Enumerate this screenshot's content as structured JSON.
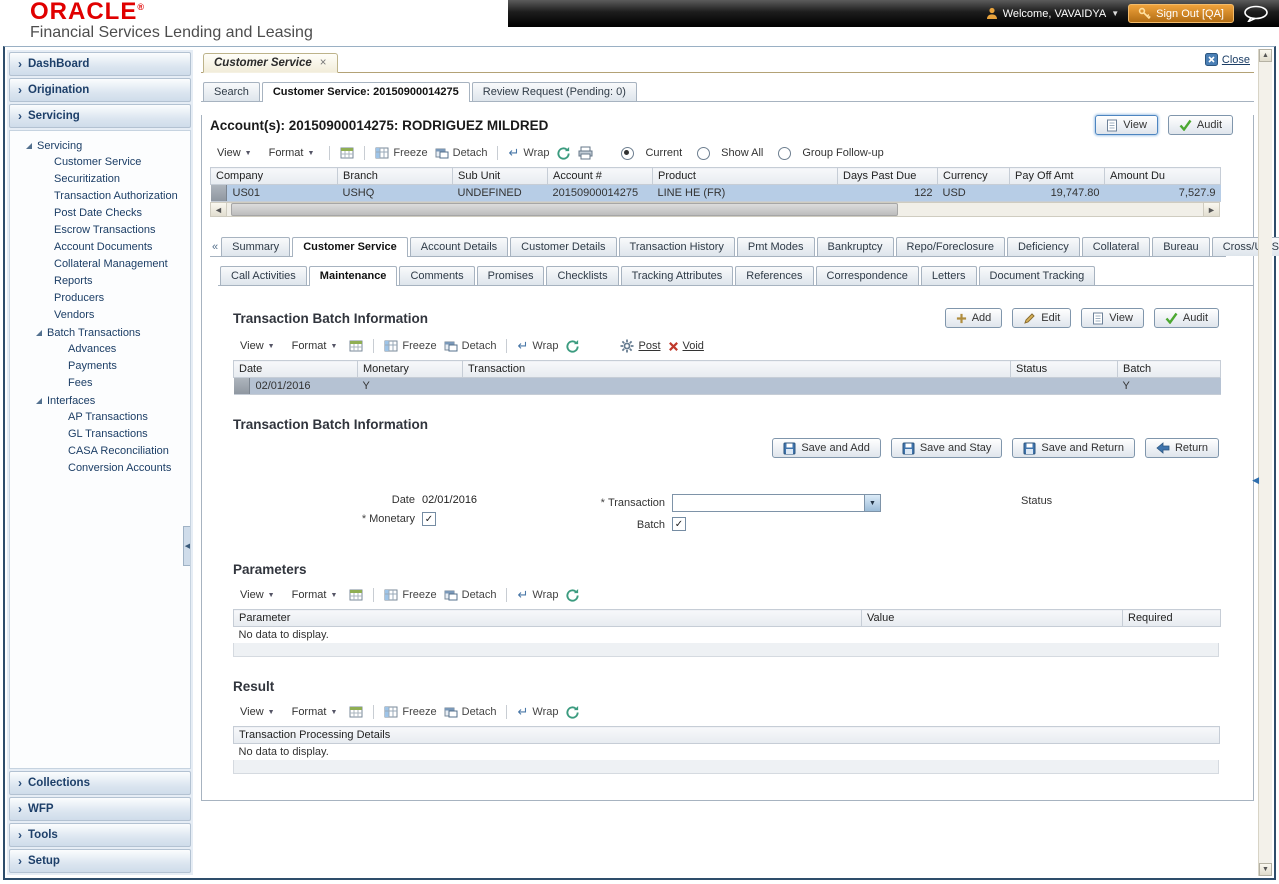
{
  "header": {
    "logo": "ORACLE",
    "registered": "®",
    "subtitle": "Financial Services Lending and Leasing",
    "welcome": "Welcome, VAVAIDYA",
    "sign_out": "Sign Out [QA]"
  },
  "sidebar": {
    "sections_top": [
      "DashBoard",
      "Origination",
      "Servicing"
    ],
    "sections_bottom": [
      "Collections",
      "WFP",
      "Tools",
      "Setup"
    ],
    "tree": {
      "root": "Servicing",
      "items": [
        "Customer Service",
        "Securitization",
        "Transaction Authorization",
        "Post Date Checks",
        "Escrow Transactions",
        "Account Documents",
        "Collateral Management",
        "Reports",
        "Producers",
        "Vendors"
      ],
      "batch_root": "Batch Transactions",
      "batch_items": [
        "Advances",
        "Payments",
        "Fees"
      ],
      "interfaces_root": "Interfaces",
      "interfaces_items": [
        "AP Transactions",
        "GL Transactions",
        "CASA Reconciliation",
        "Conversion Accounts"
      ]
    }
  },
  "workspace": {
    "tab": "Customer Service",
    "close": "Close",
    "page_tabs": [
      "Search",
      "Customer Service: 20150900014275",
      "Review Request (Pending: 0)"
    ]
  },
  "toolbar_labels": {
    "view": "View",
    "format": "Format",
    "freeze": "Freeze",
    "detach": "Detach",
    "wrap": "Wrap",
    "post": "Post",
    "void": "Void"
  },
  "account": {
    "title": "Account(s): 20150900014275: RODRIGUEZ MILDRED",
    "actions": {
      "view": "View",
      "audit": "Audit"
    },
    "radios": [
      "Current",
      "Show All",
      "Group Follow-up"
    ],
    "grid": {
      "columns": [
        "Company",
        "Branch",
        "Sub Unit",
        "Account #",
        "Product",
        "Days Past Due",
        "Currency",
        "Pay Off Amt",
        "Amount Du"
      ],
      "row": [
        "US01",
        "USHQ",
        "UNDEFINED",
        "20150900014275",
        "LINE HE (FR)",
        "122",
        "USD",
        "19,747.80",
        "7,527.9"
      ]
    }
  },
  "servicing_tabs": [
    "Summary",
    "Customer Service",
    "Account Details",
    "Customer Details",
    "Transaction History",
    "Pmt Modes",
    "Bankruptcy",
    "Repo/Foreclosure",
    "Deficiency",
    "Collateral",
    "Bureau",
    "Cross/Up Se"
  ],
  "maintenance_tabs": [
    "Call Activities",
    "Maintenance",
    "Comments",
    "Promises",
    "Checklists",
    "Tracking Attributes",
    "References",
    "Correspondence",
    "Letters",
    "Document Tracking"
  ],
  "batch_info": {
    "title": "Transaction Batch Information",
    "actions": [
      "Add",
      "Edit",
      "View",
      "Audit"
    ],
    "grid": {
      "columns": [
        "Date",
        "Monetary",
        "Transaction",
        "Status",
        "Batch"
      ],
      "row": [
        "02/01/2016",
        "Y",
        "",
        "",
        "Y"
      ]
    }
  },
  "batch_form": {
    "title": "Transaction Batch Information",
    "actions": [
      "Save and Add",
      "Save and Stay",
      "Save and Return",
      "Return"
    ],
    "required_marker": "*",
    "fields": {
      "date_label": "Date",
      "date_value": "02/01/2016",
      "monetary_label": "Monetary",
      "transaction_label": "Transaction",
      "batch_label": "Batch",
      "status_label": "Status"
    }
  },
  "parameters": {
    "title": "Parameters",
    "columns": [
      "Parameter",
      "Value",
      "Required"
    ],
    "empty": "No data to display."
  },
  "result": {
    "title": "Result",
    "columns": [
      "Transaction Processing Details"
    ],
    "empty": "No data to display."
  }
}
